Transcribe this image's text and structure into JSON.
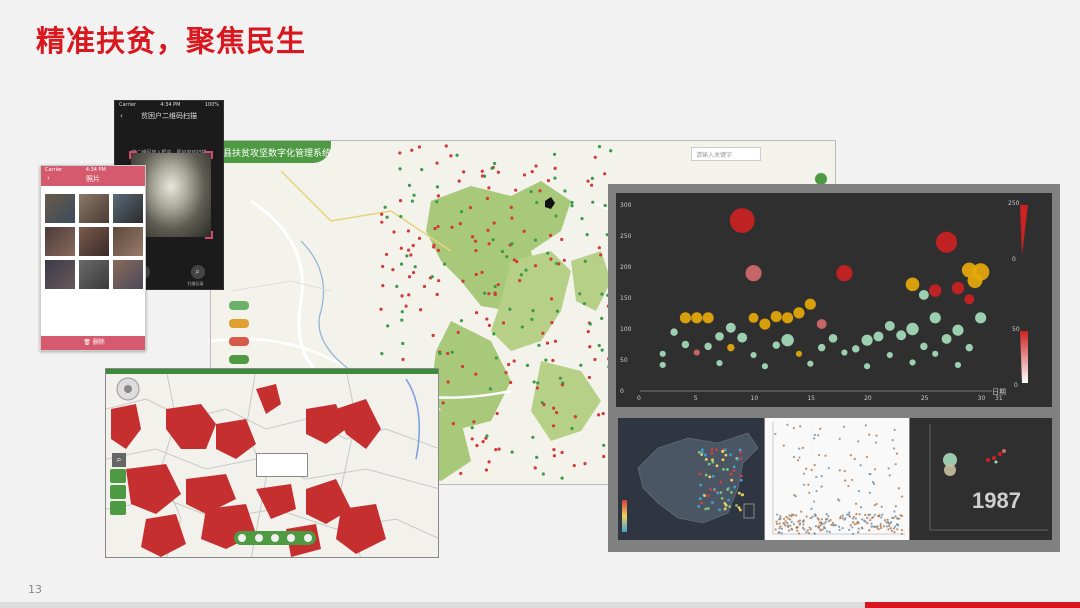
{
  "slide": {
    "title": "精准扶贫，聚焦民生",
    "page_number": "13"
  },
  "map_main": {
    "header": "县扶贫攻坚数字化管理系统",
    "search_placeholder": "请输入关键字"
  },
  "phone_scan": {
    "carrier": "Carrier",
    "time": "4:34 PM",
    "battery": "100%",
    "title": "贫困户二维码扫描",
    "hint": "将二维码放入框内，即可自动扫描",
    "btn_album": "相册",
    "btn_record": "扫描记录"
  },
  "phone_photos": {
    "carrier": "Carrier",
    "time": "4:34 PM",
    "title": "照片",
    "footer": "删除"
  },
  "bubble_chart": {
    "y_ticks": [
      "300",
      "250",
      "200",
      "150",
      "100",
      "50",
      "0"
    ],
    "x_ticks": [
      "0",
      "5",
      "10",
      "15",
      "20",
      "25",
      "30",
      "31"
    ],
    "x_label": "日期",
    "legend_top_max": "250",
    "legend_top_min": "0",
    "legend_bottom_max": "50",
    "legend_bottom_min": "0"
  },
  "year_chart": {
    "year": "1987"
  },
  "colors": {
    "title_red": "#d9171e",
    "map_green": "#4e9a43",
    "poverty_red": "#c62f2f"
  },
  "chart_data": {
    "type": "scatter",
    "xlim": [
      0,
      31
    ],
    "ylim": [
      0,
      300
    ],
    "xlabel": "日期",
    "ylabel": "",
    "points": [
      {
        "x": 9,
        "y": 275,
        "s": 20,
        "c": "#cc2222"
      },
      {
        "x": 27,
        "y": 240,
        "s": 17,
        "c": "#cc2222"
      },
      {
        "x": 10,
        "y": 190,
        "s": 13,
        "c": "#d46a6a"
      },
      {
        "x": 18,
        "y": 190,
        "s": 13,
        "c": "#cc2222"
      },
      {
        "x": 29,
        "y": 195,
        "s": 12,
        "c": "#e6a90a"
      },
      {
        "x": 30,
        "y": 192,
        "s": 14,
        "c": "#e6a90a"
      },
      {
        "x": 29.5,
        "y": 178,
        "s": 12,
        "c": "#e6a90a"
      },
      {
        "x": 24,
        "y": 172,
        "s": 11,
        "c": "#e6a90a"
      },
      {
        "x": 26,
        "y": 162,
        "s": 10,
        "c": "#cc2222"
      },
      {
        "x": 28,
        "y": 166,
        "s": 10,
        "c": "#cc2222"
      },
      {
        "x": 25,
        "y": 155,
        "s": 8,
        "c": "#a6dcbc"
      },
      {
        "x": 29,
        "y": 148,
        "s": 8,
        "c": "#cc2222"
      },
      {
        "x": 4,
        "y": 118,
        "s": 9,
        "c": "#e6a90a"
      },
      {
        "x": 5,
        "y": 118,
        "s": 9,
        "c": "#e6a90a"
      },
      {
        "x": 6,
        "y": 118,
        "s": 9,
        "c": "#e6a90a"
      },
      {
        "x": 10,
        "y": 118,
        "s": 8,
        "c": "#e6a90a"
      },
      {
        "x": 12,
        "y": 120,
        "s": 9,
        "c": "#e6a90a"
      },
      {
        "x": 13,
        "y": 118,
        "s": 9,
        "c": "#e6a90a"
      },
      {
        "x": 14,
        "y": 126,
        "s": 9,
        "c": "#e6a90a"
      },
      {
        "x": 15,
        "y": 140,
        "s": 9,
        "c": "#e6a90a"
      },
      {
        "x": 26,
        "y": 118,
        "s": 9,
        "c": "#a6dcbc"
      },
      {
        "x": 30,
        "y": 118,
        "s": 9,
        "c": "#a6dcbc"
      },
      {
        "x": 11,
        "y": 108,
        "s": 9,
        "c": "#e6a90a"
      },
      {
        "x": 8,
        "y": 102,
        "s": 8,
        "c": "#a6dcbc"
      },
      {
        "x": 16,
        "y": 108,
        "s": 8,
        "c": "#d46a6a"
      },
      {
        "x": 22,
        "y": 105,
        "s": 8,
        "c": "#a6dcbc"
      },
      {
        "x": 24,
        "y": 100,
        "s": 10,
        "c": "#a6dcbc"
      },
      {
        "x": 28,
        "y": 98,
        "s": 9,
        "c": "#a6dcbc"
      },
      {
        "x": 3,
        "y": 95,
        "s": 6,
        "c": "#a6dcbc"
      },
      {
        "x": 7,
        "y": 88,
        "s": 7,
        "c": "#a6dcbc"
      },
      {
        "x": 9,
        "y": 86,
        "s": 8,
        "c": "#a6dcbc"
      },
      {
        "x": 13,
        "y": 82,
        "s": 10,
        "c": "#a6dcbc"
      },
      {
        "x": 17,
        "y": 85,
        "s": 7,
        "c": "#a6dcbc"
      },
      {
        "x": 20,
        "y": 82,
        "s": 9,
        "c": "#a6dcbc"
      },
      {
        "x": 21,
        "y": 88,
        "s": 8,
        "c": "#a6dcbc"
      },
      {
        "x": 23,
        "y": 90,
        "s": 8,
        "c": "#a6dcbc"
      },
      {
        "x": 27,
        "y": 84,
        "s": 8,
        "c": "#a6dcbc"
      },
      {
        "x": 4,
        "y": 75,
        "s": 6,
        "c": "#a6dcbc"
      },
      {
        "x": 6,
        "y": 72,
        "s": 6,
        "c": "#a6dcbc"
      },
      {
        "x": 8,
        "y": 70,
        "s": 6,
        "c": "#e6a90a"
      },
      {
        "x": 12,
        "y": 74,
        "s": 6,
        "c": "#a6dcbc"
      },
      {
        "x": 16,
        "y": 70,
        "s": 6,
        "c": "#a6dcbc"
      },
      {
        "x": 19,
        "y": 68,
        "s": 6,
        "c": "#a6dcbc"
      },
      {
        "x": 25,
        "y": 72,
        "s": 6,
        "c": "#a6dcbc"
      },
      {
        "x": 29,
        "y": 70,
        "s": 6,
        "c": "#a6dcbc"
      },
      {
        "x": 2,
        "y": 60,
        "s": 5,
        "c": "#a6dcbc"
      },
      {
        "x": 5,
        "y": 62,
        "s": 5,
        "c": "#d46a6a"
      },
      {
        "x": 10,
        "y": 58,
        "s": 5,
        "c": "#a6dcbc"
      },
      {
        "x": 14,
        "y": 60,
        "s": 5,
        "c": "#e6a90a"
      },
      {
        "x": 18,
        "y": 62,
        "s": 5,
        "c": "#a6dcbc"
      },
      {
        "x": 22,
        "y": 58,
        "s": 5,
        "c": "#a6dcbc"
      },
      {
        "x": 26,
        "y": 60,
        "s": 5,
        "c": "#a6dcbc"
      },
      {
        "x": 2,
        "y": 42,
        "s": 5,
        "c": "#a6dcbc"
      },
      {
        "x": 7,
        "y": 45,
        "s": 5,
        "c": "#a6dcbc"
      },
      {
        "x": 11,
        "y": 40,
        "s": 5,
        "c": "#a6dcbc"
      },
      {
        "x": 15,
        "y": 44,
        "s": 5,
        "c": "#a6dcbc"
      },
      {
        "x": 20,
        "y": 40,
        "s": 5,
        "c": "#a6dcbc"
      },
      {
        "x": 24,
        "y": 46,
        "s": 5,
        "c": "#a6dcbc"
      },
      {
        "x": 28,
        "y": 42,
        "s": 5,
        "c": "#a6dcbc"
      }
    ]
  }
}
